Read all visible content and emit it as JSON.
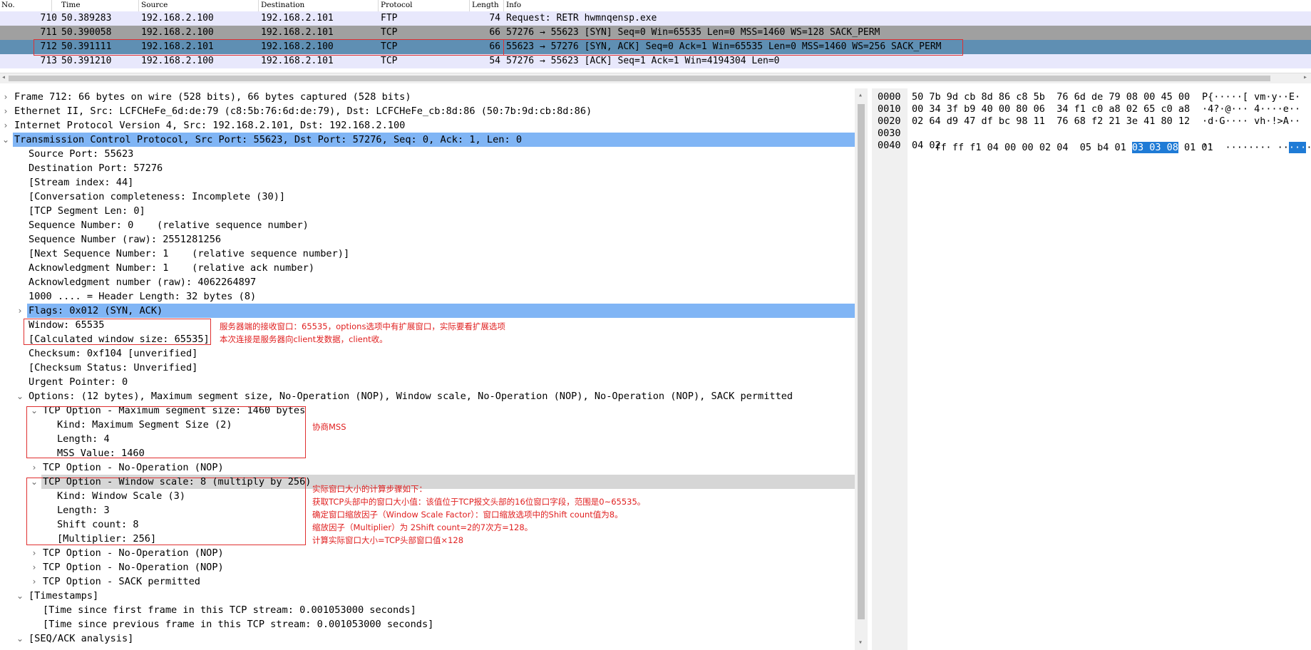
{
  "packet_list": {
    "columns": [
      "No.",
      "Time",
      "Source",
      "Destination",
      "Protocol",
      "Length",
      "Info"
    ],
    "rows": [
      {
        "no": "710",
        "time": "50.389283",
        "src": "192.168.2.100",
        "dst": "192.168.2.101",
        "proto": "FTP",
        "len": "74",
        "info": "Request: RETR hwmnqensp.exe"
      },
      {
        "no": "711",
        "time": "50.390058",
        "src": "192.168.2.100",
        "dst": "192.168.2.101",
        "proto": "TCP",
        "len": "66",
        "info": "57276 → 55623 [SYN] Seq=0 Win=65535 Len=0 MSS=1460 WS=128 SACK_PERM"
      },
      {
        "no": "712",
        "time": "50.391111",
        "src": "192.168.2.101",
        "dst": "192.168.2.100",
        "proto": "TCP",
        "len": "66",
        "info": "55623 → 57276 [SYN, ACK] Seq=0 Ack=1 Win=65535 Len=0 MSS=1460 WS=256 SACK_PERM"
      },
      {
        "no": "713",
        "time": "50.391210",
        "src": "192.168.2.100",
        "dst": "192.168.2.101",
        "proto": "TCP",
        "len": "54",
        "info": "57276 → 55623 [ACK] Seq=1 Ack=1 Win=4194304 Len=0"
      }
    ]
  },
  "details": [
    {
      "text": "Frame 712: 66 bytes on wire (528 bits), 66 bytes captured (528 bits)",
      "expander": "›"
    },
    {
      "text": "Ethernet II, Src: LCFCHeFe_6d:de:79 (c8:5b:76:6d:de:79), Dst: LCFCHeFe_cb:8d:86 (50:7b:9d:cb:8d:86)",
      "expander": "›"
    },
    {
      "text": "Internet Protocol Version 4, Src: 192.168.2.101, Dst: 192.168.2.100",
      "expander": "›"
    },
    {
      "text": "Transmission Control Protocol, Src Port: 55623, Dst Port: 57276, Seq: 0, Ack: 1, Len: 0",
      "expander": "⌄"
    },
    {
      "text": "Source Port: 55623",
      "expander": ""
    },
    {
      "text": "Destination Port: 57276",
      "expander": ""
    },
    {
      "text": "[Stream index: 44]",
      "expander": ""
    },
    {
      "text": "[Conversation completeness: Incomplete (30)]",
      "expander": ""
    },
    {
      "text": "[TCP Segment Len: 0]",
      "expander": ""
    },
    {
      "text": "Sequence Number: 0    (relative sequence number)",
      "expander": ""
    },
    {
      "text": "Sequence Number (raw): 2551281256",
      "expander": ""
    },
    {
      "text": "[Next Sequence Number: 1    (relative sequence number)]",
      "expander": ""
    },
    {
      "text": "Acknowledgment Number: 1    (relative ack number)",
      "expander": ""
    },
    {
      "text": "Acknowledgment number (raw): 4062264897",
      "expander": ""
    },
    {
      "text": "1000 .... = Header Length: 32 bytes (8)",
      "expander": ""
    },
    {
      "text": "Flags: 0x012 (SYN, ACK)",
      "expander": "›"
    },
    {
      "text": "Window: 65535",
      "expander": ""
    },
    {
      "text": "[Calculated window size: 65535]",
      "expander": ""
    },
    {
      "text": "Checksum: 0xf104 [unverified]",
      "expander": ""
    },
    {
      "text": "[Checksum Status: Unverified]",
      "expander": ""
    },
    {
      "text": "Urgent Pointer: 0",
      "expander": ""
    },
    {
      "text": "Options: (12 bytes), Maximum segment size, No-Operation (NOP), Window scale, No-Operation (NOP), No-Operation (NOP), SACK permitted",
      "expander": "⌄"
    },
    {
      "text": "TCP Option - Maximum segment size: 1460 bytes",
      "expander": "⌄"
    },
    {
      "text": "Kind: Maximum Segment Size (2)",
      "expander": ""
    },
    {
      "text": "Length: 4",
      "expander": ""
    },
    {
      "text": "MSS Value: 1460",
      "expander": ""
    },
    {
      "text": "TCP Option - No-Operation (NOP)",
      "expander": "›"
    },
    {
      "text": "TCP Option - Window scale: 8 (multiply by 256)",
      "expander": "⌄"
    },
    {
      "text": "Kind: Window Scale (3)",
      "expander": ""
    },
    {
      "text": "Length: 3",
      "expander": ""
    },
    {
      "text": "Shift count: 8",
      "expander": ""
    },
    {
      "text": "[Multiplier: 256]",
      "expander": ""
    },
    {
      "text": "TCP Option - No-Operation (NOP)",
      "expander": "›"
    },
    {
      "text": "TCP Option - No-Operation (NOP)",
      "expander": "›"
    },
    {
      "text": "TCP Option - SACK permitted",
      "expander": "›"
    },
    {
      "text": "[Timestamps]",
      "expander": "⌄"
    },
    {
      "text": "[Time since first frame in this TCP stream: 0.001053000 seconds]",
      "expander": ""
    },
    {
      "text": "[Time since previous frame in this TCP stream: 0.001053000 seconds]",
      "expander": ""
    },
    {
      "text": "[SEQ/ACK analysis]",
      "expander": "⌄"
    }
  ],
  "hex": {
    "offsets": [
      "0000",
      "0010",
      "0020",
      "0030",
      "0040"
    ],
    "bytes": [
      "50 7b 9d cb 8d 86 c8 5b  76 6d de 79 08 00 45 00",
      "00 34 3f b9 40 00 80 06  34 f1 c0 a8 02 65 c0 a8",
      "02 64 d9 47 df bc 98 11  76 68 f2 21 3e 41 80 12",
      "ff ff f1 04 00 00 02 04  05 b4 01 ",
      "04 02"
    ],
    "selected_bytes": "03 03 08",
    "row3_tail": " 01 01",
    "ascii": [
      "P{·····[ vm·y··E·",
      "·4?·@··· 4····e··",
      "·d·G···· vh·!>A··",
      "········ ··",
      "··"
    ],
    "ascii_selected": "···",
    "ascii_row3_tail": "··"
  },
  "annotations": {
    "window_note_1": "服务器端的接收窗口：65535，options选项中有扩展窗口，实际要看扩展选项",
    "window_note_2": "本次连接是服务器向client发数据，client收。",
    "mss_note": "协商MSS",
    "scale_note_1": "实际窗口大小的计算步骤如下：",
    "scale_note_2": "获取TCP头部中的窗口大小值：该值位于TCP报文头部的16位窗口字段，范围是0~65535。",
    "scale_note_3": "确定窗口缩放因子（Window Scale Factor）：窗口缩放选项中的Shift count值为8。",
    "scale_note_4": "缩放因子（Multiplier）为 2Shift count=2的7次方=128。",
    "scale_note_5": "计算实际窗口大小=TCP头部窗口值×128"
  },
  "colors": {
    "selected_row": "#5f8fb3",
    "syn_row": "#a0a0a0",
    "light_row": "#e8e8fc",
    "tree_highlight": "#80b5f5",
    "annotation_red": "#e02020"
  }
}
